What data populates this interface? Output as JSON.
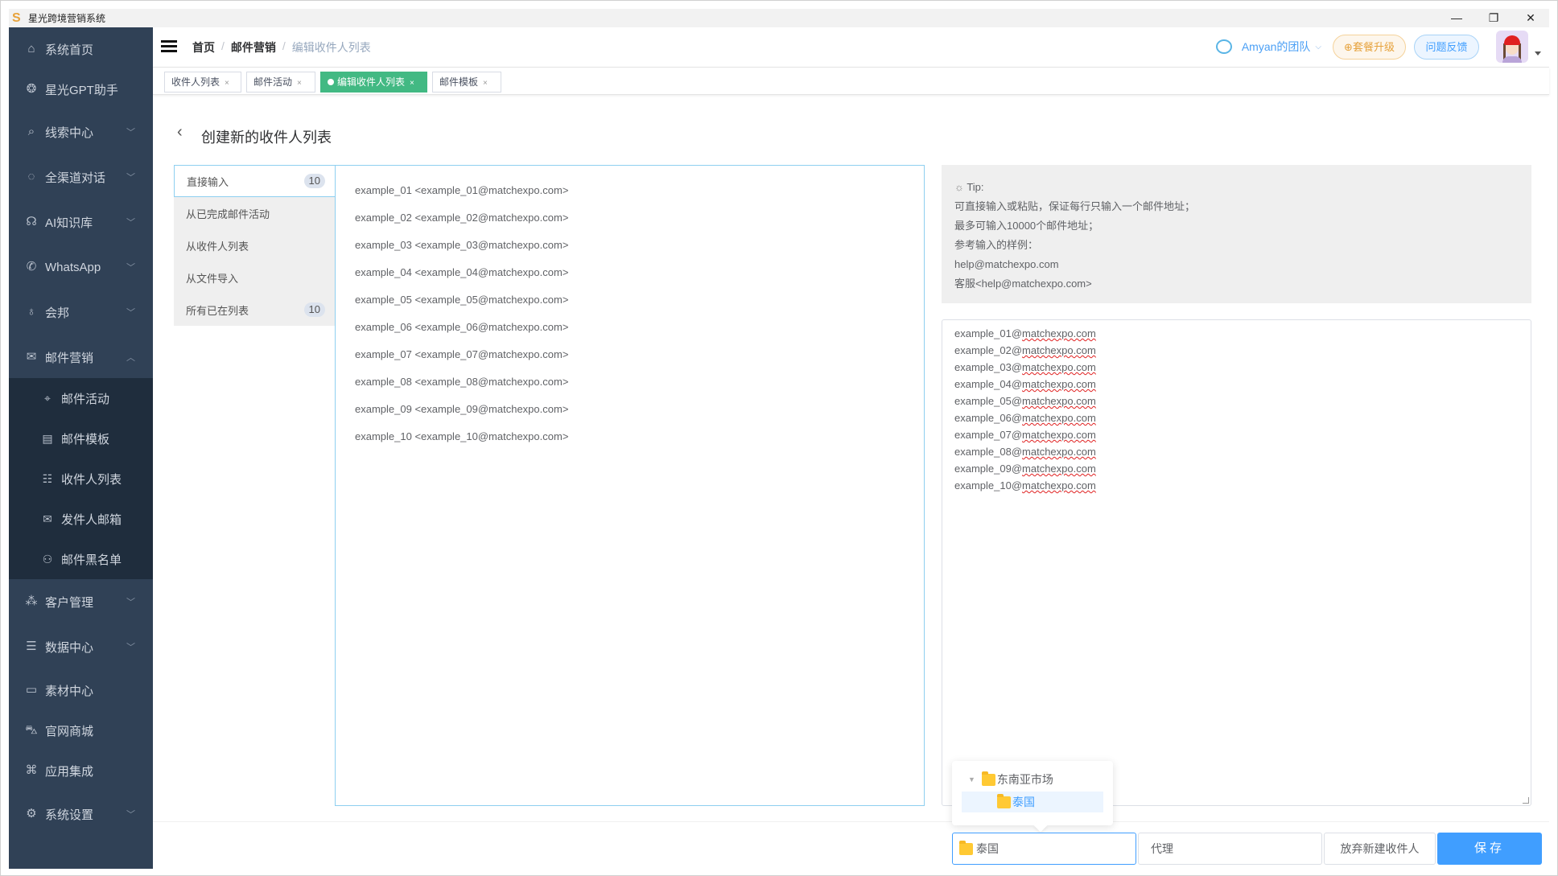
{
  "window": {
    "title": "星光跨境营销系统",
    "controls": {
      "minimize": "—",
      "maximize": "❐",
      "close": "✕"
    }
  },
  "sidebar": {
    "items": [
      {
        "label": "系统首页",
        "icon": "home-icon",
        "glyph": "⌂",
        "expandable": false
      },
      {
        "label": "星光GPT助手",
        "icon": "gpt-icon",
        "glyph": "❂",
        "expandable": false
      },
      {
        "label": "线索中心",
        "icon": "search-box-icon",
        "glyph": "⌕",
        "expandable": true
      },
      {
        "label": "全渠道对话",
        "icon": "chat-bubbles-icon",
        "glyph": "◌",
        "expandable": true
      },
      {
        "label": "AI知识库",
        "icon": "ai-brain-icon",
        "glyph": "☊",
        "expandable": true
      },
      {
        "label": "WhatsApp",
        "icon": "whatsapp-icon",
        "glyph": "✆",
        "expandable": true
      },
      {
        "label": "会邦",
        "icon": "bulb-icon",
        "glyph": "♁",
        "expandable": true
      },
      {
        "label": "邮件营销",
        "icon": "mail-icon",
        "glyph": "✉",
        "expandable": true,
        "expanded": true
      },
      {
        "label": "客户管理",
        "icon": "customers-icon",
        "glyph": "⁂",
        "expandable": true
      },
      {
        "label": "数据中心",
        "icon": "database-icon",
        "glyph": "☰",
        "expandable": true
      },
      {
        "label": "素材中心",
        "icon": "folder-icon",
        "glyph": "▭",
        "expandable": false
      },
      {
        "label": "官网商城",
        "icon": "cart-icon",
        "glyph": "⛍",
        "expandable": false
      },
      {
        "label": "应用集成",
        "icon": "apps-icon",
        "glyph": "⌘",
        "expandable": false
      },
      {
        "label": "系统设置",
        "icon": "gear-icon",
        "glyph": "⚙",
        "expandable": true
      }
    ],
    "submenu": [
      {
        "label": "邮件活动",
        "icon": "tag-icon",
        "glyph": "⌖"
      },
      {
        "label": "邮件模板",
        "icon": "template-icon",
        "glyph": "▤"
      },
      {
        "label": "收件人列表",
        "icon": "list-icon",
        "glyph": "☷"
      },
      {
        "label": "发件人邮箱",
        "icon": "inbox-icon",
        "glyph": "✉"
      },
      {
        "label": "邮件黑名单",
        "icon": "user-block-icon",
        "glyph": "⚇"
      }
    ]
  },
  "header": {
    "breadcrumb": [
      "首页",
      "邮件营销",
      "编辑收件人列表"
    ],
    "separator": "/",
    "team": "Amyan的团队",
    "upgrade": "⊕套餐升级",
    "feedback": "问题反馈"
  },
  "tabs": [
    {
      "label": "收件人列表",
      "active": false
    },
    {
      "label": "邮件活动",
      "active": false
    },
    {
      "label": "编辑收件人列表",
      "active": true
    },
    {
      "label": "邮件模板",
      "active": false
    }
  ],
  "page": {
    "title": "创建新的收件人列表",
    "sources": [
      {
        "label": "直接输入",
        "count": "10",
        "active": true
      },
      {
        "label": "从已完成邮件活动",
        "count": null
      },
      {
        "label": "从收件人列表",
        "count": null
      },
      {
        "label": "从文件导入",
        "count": null
      },
      {
        "label": "所有已在列表",
        "count": "10"
      }
    ],
    "preview": [
      "example_01 <example_01@matchexpo.com>",
      "example_02 <example_02@matchexpo.com>",
      "example_03 <example_03@matchexpo.com>",
      "example_04 <example_04@matchexpo.com>",
      "example_05 <example_05@matchexpo.com>",
      "example_06 <example_06@matchexpo.com>",
      "example_07 <example_07@matchexpo.com>",
      "example_08 <example_08@matchexpo.com>",
      "example_09 <example_09@matchexpo.com>",
      "example_10 <example_10@matchexpo.com>"
    ],
    "tip": {
      "title": "Tip:",
      "lines": [
        "可直接输入或粘贴，保证每行只输入一个邮件地址；",
        "最多可输入10000个邮件地址；",
        "参考输入的样例：",
        "help@matchexpo.com",
        "客服<help@matchexpo.com>"
      ]
    },
    "textarea_lines": [
      {
        "local": "example_01@",
        "domain": "matchexpo.com"
      },
      {
        "local": "example_02@",
        "domain": "matchexpo.com"
      },
      {
        "local": "example_03@",
        "domain": "matchexpo.com"
      },
      {
        "local": "example_04@",
        "domain": "matchexpo.com"
      },
      {
        "local": "example_05@",
        "domain": "matchexpo.com"
      },
      {
        "local": "example_06@",
        "domain": "matchexpo.com"
      },
      {
        "local": "example_07@",
        "domain": "matchexpo.com"
      },
      {
        "local": "example_08@",
        "domain": "matchexpo.com"
      },
      {
        "local": "example_09@",
        "domain": "matchexpo.com"
      },
      {
        "local": "example_10@",
        "domain": "matchexpo.com"
      }
    ]
  },
  "tree_popover": {
    "parent": "东南亚市场",
    "child": "泰国"
  },
  "footer": {
    "group_value": "泰国",
    "tag_value": "代理",
    "discard": "放弃新建收件人",
    "save": "保存"
  },
  "colors": {
    "sidebar": "#304156",
    "submenu": "#1f2d3d",
    "active_tab": "#42b983",
    "primary": "#409eff",
    "warning": "#e6a23c"
  }
}
